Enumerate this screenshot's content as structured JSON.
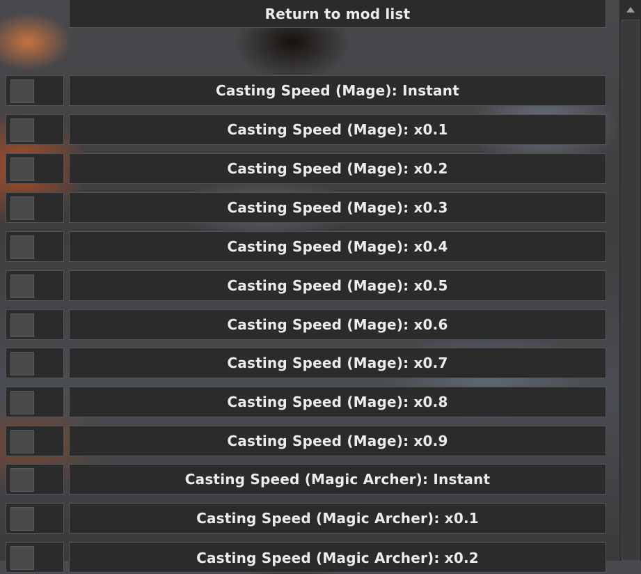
{
  "header": {
    "return_label": "Return to mod list"
  },
  "options": [
    {
      "label": "Casting Speed (Mage): Instant",
      "enabled": false
    },
    {
      "label": "Casting Speed (Mage): x0.1",
      "enabled": false
    },
    {
      "label": "Casting Speed (Mage): x0.2",
      "enabled": false
    },
    {
      "label": "Casting Speed (Mage): x0.3",
      "enabled": false
    },
    {
      "label": "Casting Speed (Mage): x0.4",
      "enabled": false
    },
    {
      "label": "Casting Speed (Mage): x0.5",
      "enabled": false
    },
    {
      "label": "Casting Speed (Mage): x0.6",
      "enabled": false
    },
    {
      "label": "Casting Speed (Mage): x0.7",
      "enabled": false
    },
    {
      "label": "Casting Speed (Mage): x0.8",
      "enabled": false
    },
    {
      "label": "Casting Speed (Mage): x0.9",
      "enabled": false
    },
    {
      "label": "Casting Speed (Magic Archer): Instant",
      "enabled": false
    },
    {
      "label": "Casting Speed (Magic Archer): x0.1",
      "enabled": false
    },
    {
      "label": "Casting Speed (Magic Archer): x0.2",
      "enabled": false
    }
  ],
  "icons": {
    "scroll_up": "triangle-up-icon"
  },
  "colors": {
    "button_bg": "#2b2b2b",
    "button_border": "#555555",
    "text": "#ececec",
    "toggle_off": "#4a4a4a"
  }
}
